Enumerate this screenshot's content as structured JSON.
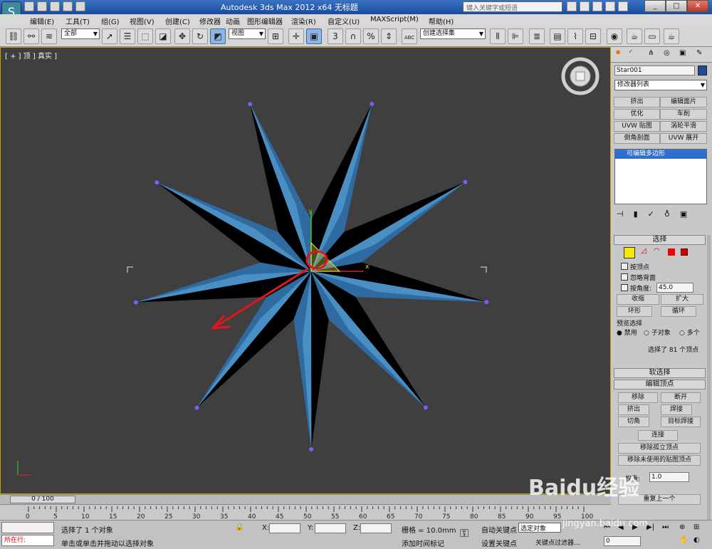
{
  "titlebar": {
    "title": "Autodesk 3ds Max  2012 x64      无标题",
    "search_placeholder": "键入关键字或短语"
  },
  "menu": {
    "items": [
      "编辑(E)",
      "工具(T)",
      "组(G)",
      "视图(V)",
      "创建(C)",
      "修改器",
      "动画",
      "图形编辑器",
      "渲染(R)",
      "自定义(U)",
      "MAXScript(M)",
      "帮助(H)"
    ]
  },
  "toolbar": {
    "filter_select": "全部",
    "view_select": "视图",
    "selection_set": "创建选择集",
    "snap_3": "3",
    "percent_label": "%",
    "abc_label": "ABC"
  },
  "viewport": {
    "label": "[ + ] 顶 ] 真实 ]",
    "axis_x": "x",
    "axis_y": "y"
  },
  "colors": {
    "star": "#2f6aa0",
    "star_light": "#4a8fc4",
    "selection_bracket": "#e6e6e6",
    "annotation_red": "#e0161a",
    "vertex": "#7a5cff"
  },
  "command_panel": {
    "object_name": "Star001",
    "modifier_list": "修改器列表",
    "mod_buttons": [
      "挤出",
      "编辑面片",
      "优化",
      "车削",
      "UVW 贴图",
      "涡轮平滑",
      "倒角剖面",
      "UVW 展开"
    ],
    "stack_item": "可编辑多边形",
    "select_rollout": {
      "title": "选择",
      "by_vertex": "按顶点",
      "ignore_backfacing": "忽略背面",
      "by_angle": "按角度:",
      "angle_value": "45.0",
      "shrink": "收缩",
      "grow": "扩大",
      "ring": "环形",
      "loop": "循环",
      "preview_title": "预览选择",
      "preview_off": "禁用",
      "preview_sub": "子对象",
      "preview_multi": "多个",
      "status": "选择了 81 个顶点"
    },
    "soft_select": "软选择",
    "edit_vertices": {
      "title": "编辑顶点",
      "remove": "移除",
      "break": "断开",
      "extrude": "挤出",
      "weld": "焊接",
      "chamfer": "切角",
      "target_weld": "目标焊接",
      "connect": "连接",
      "remove_isolated": "移除孤立顶点",
      "remove_unused": "移除未使用的贴图顶点",
      "weight_label": "权重:",
      "weight_value": "1.0",
      "bottom_btn": "重复上一个"
    }
  },
  "timeline": {
    "frame_label": "0 / 100",
    "ticks": [
      "0",
      "5",
      "10",
      "15",
      "20",
      "25",
      "30",
      "35",
      "40",
      "45",
      "50",
      "55",
      "60",
      "65",
      "70",
      "75",
      "80",
      "85",
      "90",
      "95",
      "100"
    ]
  },
  "status": {
    "running_label": "所在行:",
    "selection_msg": "选择了 1 个对象",
    "hint": "单击或单击并拖动以选择对象",
    "x_label": "X:",
    "y_label": "Y:",
    "z_label": "Z:",
    "grid": "栅格 = 10.0mm",
    "add_time_tag": "添加时间标记",
    "auto_key": "自动关键点",
    "selected_obj": "选定对象",
    "set_key": "设置关键点",
    "key_filters": "关键点过滤器...",
    "frame_field": "0"
  },
  "watermark": {
    "main": "Baidu经验",
    "sub": "jingyan.baidu.com"
  }
}
